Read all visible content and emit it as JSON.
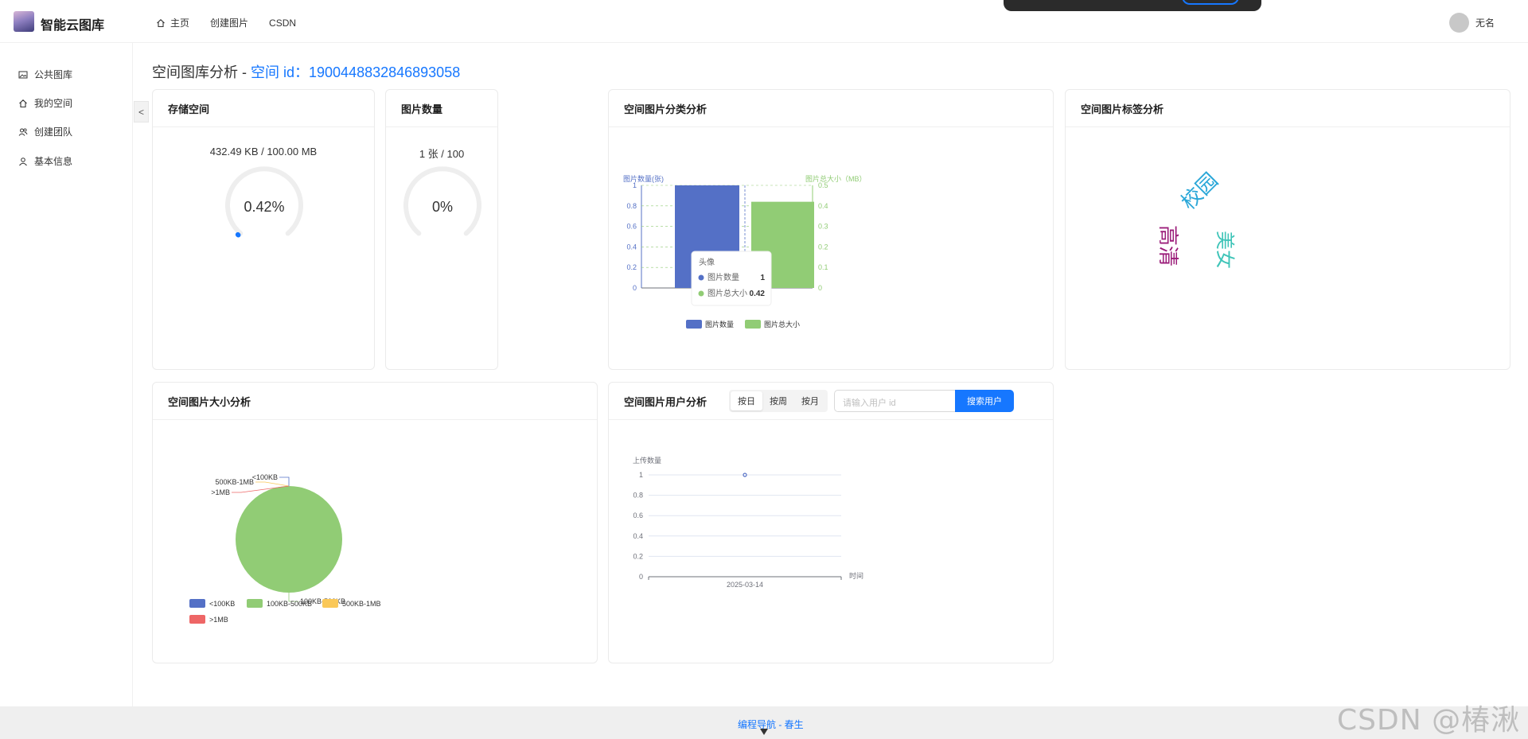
{
  "header": {
    "logo_text": "智能云图库",
    "nav": [
      {
        "label": "主页",
        "icon": "home-icon"
      },
      {
        "label": "创建图片",
        "icon": ""
      },
      {
        "label": "CSDN",
        "icon": ""
      }
    ],
    "user_name": "无名"
  },
  "sidebar": {
    "items": [
      {
        "label": "公共图库",
        "icon": "picture-icon"
      },
      {
        "label": "我的空间",
        "icon": "home-icon"
      },
      {
        "label": "创建团队",
        "icon": "team-icon"
      },
      {
        "label": "基本信息",
        "icon": "user-icon"
      }
    ],
    "collapse_label": "<"
  },
  "page": {
    "title_prefix": "空间图库分析 - ",
    "title_space": "空间 id：1900448832846893058"
  },
  "storage": {
    "title": "存储空间",
    "usage_text": "432.49 KB / 100.00 MB",
    "percent_text": "0.42%",
    "percent_value": 0.42
  },
  "count": {
    "title": "图片数量",
    "usage_text": "1 张 / 100",
    "percent_text": "0%",
    "percent_value": 0
  },
  "category": {
    "title": "空间图片分类分析",
    "chart_data": {
      "type": "bar",
      "categories": [
        "头像"
      ],
      "series": [
        {
          "name": "图片数量",
          "values": [
            1
          ],
          "axis": "left",
          "color": "#5470c6"
        },
        {
          "name": "图片总大小",
          "values": [
            0.42
          ],
          "axis": "right",
          "color": "#91cc75"
        }
      ],
      "ylabel_left": "图片数量(张)",
      "ylabel_right": "图片总大小（MB）",
      "ylim_left": [
        0,
        1
      ],
      "ylim_right": [
        0,
        0.5
      ],
      "yticks_left": [
        "0",
        "0.2",
        "0.4",
        "0.6",
        "0.8",
        "1"
      ],
      "yticks_right": [
        "0",
        "0.1",
        "0.2",
        "0.3",
        "0.4",
        "0.5"
      ],
      "legend": [
        "图片数量",
        "图片总大小"
      ],
      "tooltip": {
        "title": "头像",
        "rows": [
          {
            "name": "图片数量",
            "value": "1"
          },
          {
            "name": "图片总大小",
            "value": "0.42"
          }
        ]
      }
    }
  },
  "tags": {
    "title": "空间图片标签分析",
    "words": [
      {
        "text": "高清",
        "color": "#9b1d7a"
      },
      {
        "text": "校园",
        "color": "#2aa7d8"
      },
      {
        "text": "美女",
        "color": "#3fc4b8"
      }
    ]
  },
  "size": {
    "title": "空间图片大小分析",
    "chart_data": {
      "type": "pie",
      "slices": [
        {
          "name": "<100KB",
          "value": 0,
          "color": "#5470c6"
        },
        {
          "name": "100KB-500KB",
          "value": 1,
          "color": "#91cc75"
        },
        {
          "name": "500KB-1MB",
          "value": 0,
          "color": "#fac858"
        },
        {
          "name": ">1MB",
          "value": 0,
          "color": "#ee6666"
        }
      ],
      "legend": [
        "<100KB",
        "100KB-500KB",
        "500KB-1MB",
        ">1MB"
      ]
    }
  },
  "users": {
    "title": "空间图片用户分析",
    "segments": [
      "按日",
      "按周",
      "按月"
    ],
    "active_segment": "按日",
    "search_placeholder": "请输入用户 id",
    "search_button": "搜索用户",
    "chart_data": {
      "type": "line",
      "x": [
        "2025-03-14"
      ],
      "values": [
        1
      ],
      "ylabel": "上传数量",
      "xlabel": "时间",
      "ylim": [
        0,
        1
      ],
      "yticks": [
        "0",
        "0.2",
        "0.4",
        "0.6",
        "0.8",
        "1"
      ]
    }
  },
  "footer": {
    "text": "编程导航 - 春生"
  },
  "watermark": "CSDN @椿湫",
  "colors": {
    "accent": "#1677ff"
  }
}
